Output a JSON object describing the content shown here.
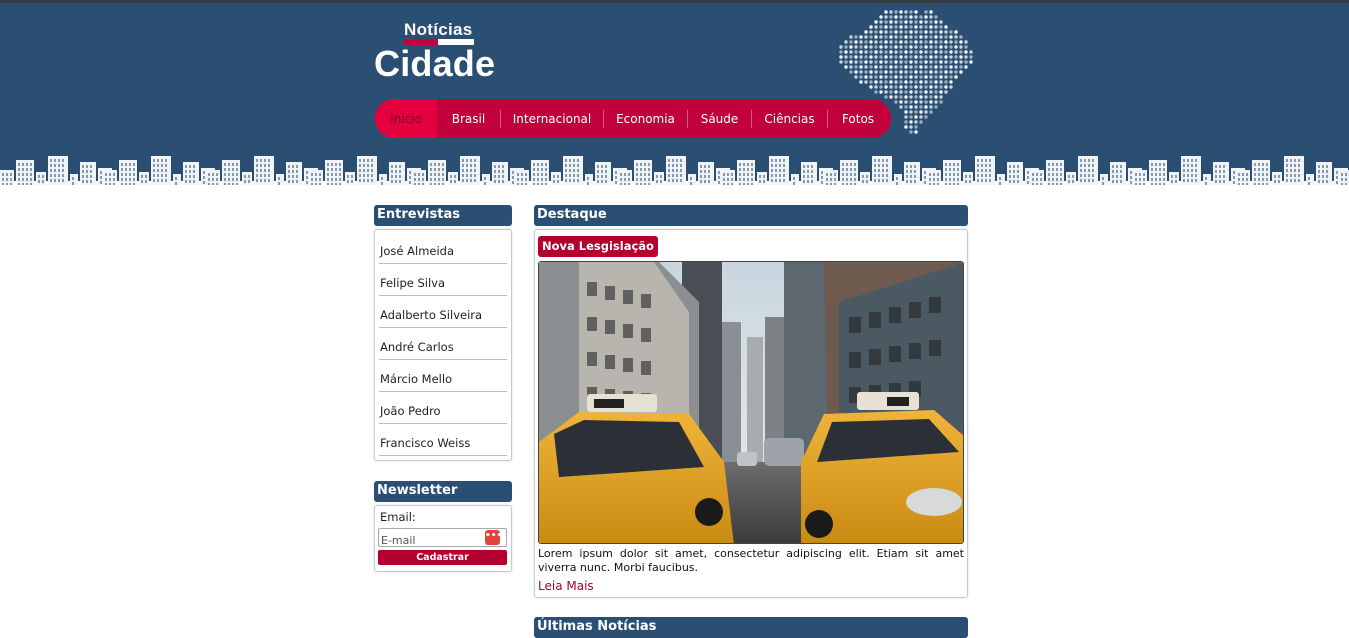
{
  "brand": {
    "top": "Notícias",
    "bottom": "Cidade",
    "colors": {
      "header": "#2b4f73",
      "accent": "#c2003b",
      "active": "#e4003f"
    }
  },
  "nav": {
    "items": [
      {
        "label": "Início",
        "active": true
      },
      {
        "label": "Brasil",
        "active": false
      },
      {
        "label": "Internacional",
        "active": false
      },
      {
        "label": "Economia",
        "active": false
      },
      {
        "label": "Sáude",
        "active": false
      },
      {
        "label": "Ciências",
        "active": false
      },
      {
        "label": "Fotos",
        "active": false
      }
    ]
  },
  "interviews": {
    "title": "Entrevistas",
    "items": [
      "José Almeida",
      "Felipe Silva",
      "Adalberto Silveira",
      "André Carlos",
      "Márcio Mello",
      "João Pedro",
      "Francisco Weiss"
    ]
  },
  "newsletter": {
    "title": "Newsletter",
    "label": "Email:",
    "placeholder": "E-mail",
    "icon": "password-manager-icon",
    "button": "Cadastrar"
  },
  "featured": {
    "title": "Destaque",
    "tag": "Nova Lesgislação",
    "image": "city-street-taxis-photo",
    "text": "Lorem ipsum dolor sit amet, consectetur adipiscing elit. Etiam sit amet viverra nunc. Morbi faucibus.",
    "more": "Leia Mais"
  },
  "latest": {
    "title": "Últimas Notícias"
  }
}
